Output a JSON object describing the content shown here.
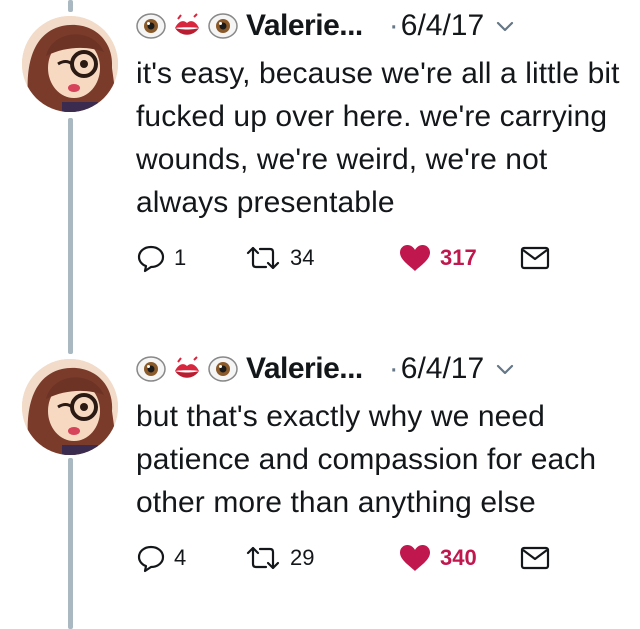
{
  "colors": {
    "like": "#c0174e",
    "muted": "#657786",
    "thread_line": "#aab8c2",
    "text": "#14171a"
  },
  "icons": {
    "header_emoji": [
      "eye-icon",
      "kiss-mark-icon",
      "eye-icon"
    ],
    "caret": "chevron-down-icon",
    "actions": [
      "reply-icon",
      "retweet-icon",
      "heart-icon",
      "direct-message-icon"
    ]
  },
  "tweets": [
    {
      "name": "Valerie...",
      "dot": "·",
      "date": "6/4/17",
      "text": "it's easy, because we're all a little bit fucked up over here. we're carrying wounds, we're weird, we're not always presentable",
      "replies": "1",
      "retweets": "34",
      "likes": "317"
    },
    {
      "name": "Valerie...",
      "dot": "·",
      "date": "6/4/17",
      "text": "but that's exactly why we need patience and compassion for each other more than anything else",
      "replies": "4",
      "retweets": "29",
      "likes": "340"
    }
  ]
}
